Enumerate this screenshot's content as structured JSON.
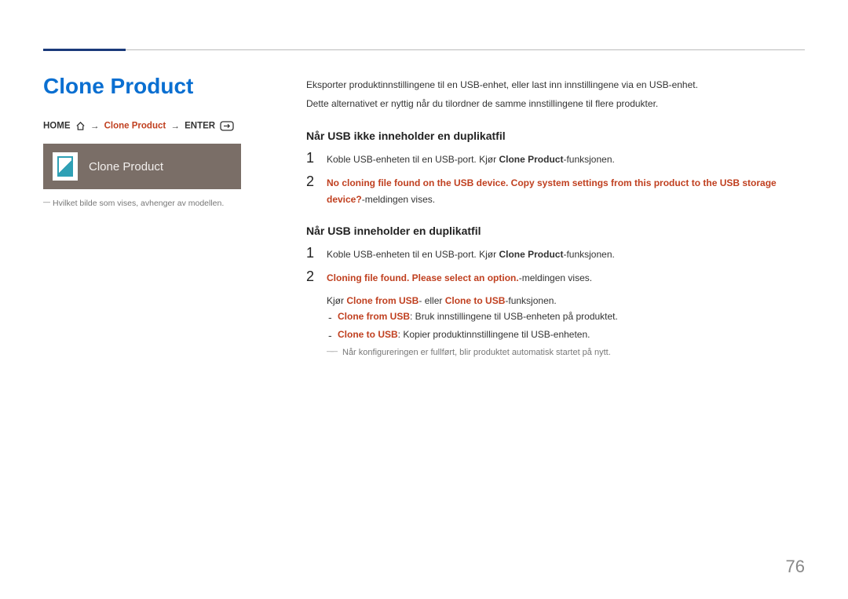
{
  "title": "Clone Product",
  "nav": {
    "home": "HOME",
    "step2": "Clone Product",
    "enter": "ENTER"
  },
  "tile": {
    "label": "Clone Product"
  },
  "left_footnote": "Hvilket bilde som vises, avhenger av modellen.",
  "intro": {
    "line1": "Eksporter produktinnstillingene til en USB-enhet, eller last inn innstillingene via en USB-enhet.",
    "line2": "Dette alternativet er nyttig når du tilordner de samme innstillingene til flere produkter."
  },
  "section1": {
    "heading": "Når USB ikke inneholder en duplikatfil",
    "step1_a": "Koble USB-enheten til en USB-port. Kjør ",
    "step1_b": "Clone Product",
    "step1_c": "-funksjonen.",
    "step2_a": "No cloning file found on the USB device. Copy system settings from this product to the USB storage device?",
    "step2_b": "-meldingen vises."
  },
  "section2": {
    "heading": "Når USB inneholder en duplikatfil",
    "step1_a": "Koble USB-enheten til en USB-port. Kjør ",
    "step1_b": "Clone Product",
    "step1_c": "-funksjonen.",
    "step2_a": "Cloning file found. Please select an option.",
    "step2_b": "-meldingen vises.",
    "run_a": "Kjør ",
    "run_b": "Clone from USB",
    "run_c": "- eller ",
    "run_d": "Clone to USB",
    "run_e": "-funksjonen.",
    "sub1_a": "Clone from USB",
    "sub1_b": ": Bruk innstillingene til USB-enheten på produktet.",
    "sub2_a": "Clone to USB",
    "sub2_b": ": Kopier produktinnstillingene til USB-enheten.",
    "sub_note": "Når konfigureringen er fullført, blir produktet automatisk startet på nytt."
  },
  "page_number": "76"
}
